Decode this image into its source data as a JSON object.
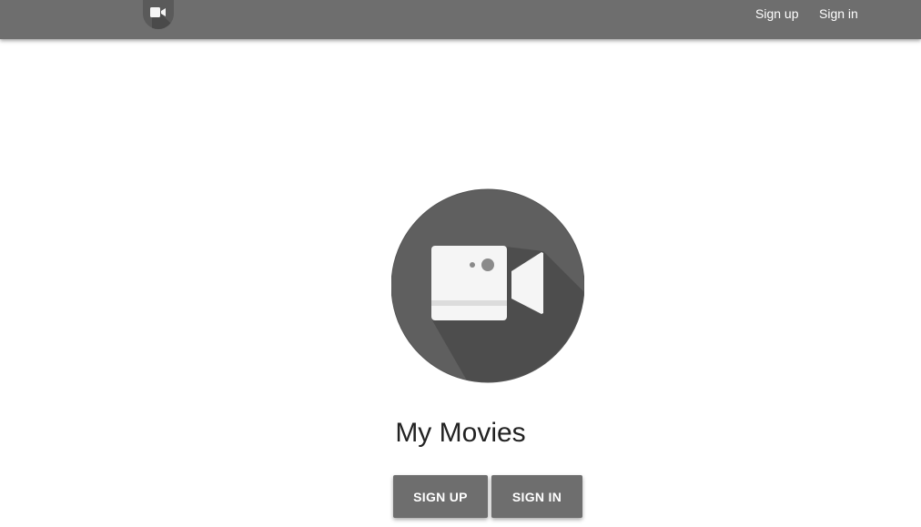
{
  "header": {
    "logo_icon": "video-camera-icon",
    "nav": {
      "signup_label": "Sign up",
      "signin_label": "Sign in"
    }
  },
  "hero": {
    "logo_icon": "video-camera-icon",
    "title": "My Movies",
    "signup_button": "SIGN UP",
    "signin_button": "SIGN IN"
  },
  "colors": {
    "topbar": "#6e6e6e",
    "button": "#6e6e6e",
    "logo_circle": "#5f5f5f",
    "logo_shadow": "#505050",
    "camera_body": "#f5f5f5"
  }
}
